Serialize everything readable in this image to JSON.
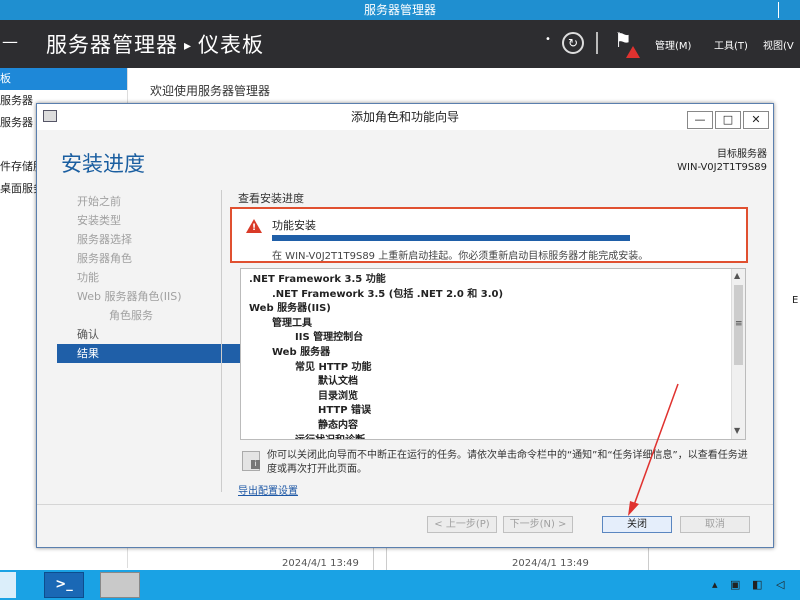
{
  "window_title": "服务器管理器",
  "header": {
    "crumb_app": "服务器管理器",
    "crumb_sep": "▸",
    "crumb_page": "仪表板",
    "menu_manage": "管理(M)",
    "menu_tools": "工具(T)",
    "menu_view": "视图(V"
  },
  "sidebar": {
    "items": [
      "板",
      "服务器",
      "服务器",
      "",
      "件存储服",
      "桌面服务"
    ]
  },
  "welcome": "欢迎使用服务器管理器",
  "right_edge": "E",
  "tiles": {
    "timestamp_1": "2024/4/1 13:49",
    "timestamp_2": "2024/4/1 13:49"
  },
  "wizard": {
    "title": "添加角色和功能向导",
    "btn_minimize": "—",
    "btn_maximize": "□",
    "btn_close": "✕",
    "heading": "安装进度",
    "dest_label": "目标服务器",
    "dest_server": "WIN-V0J2T1T9S89",
    "steps": [
      {
        "label": "开始之前",
        "state": "inactive"
      },
      {
        "label": "安装类型",
        "state": "inactive"
      },
      {
        "label": "服务器选择",
        "state": "inactive"
      },
      {
        "label": "服务器角色",
        "state": "inactive"
      },
      {
        "label": "功能",
        "state": "inactive"
      },
      {
        "label": "Web 服务器角色(IIS)",
        "state": "inactive"
      },
      {
        "label": "角色服务",
        "state": "inactive-sub"
      },
      {
        "label": "确认",
        "state": "done"
      },
      {
        "label": "结果",
        "state": "current"
      }
    ],
    "view_progress_label": "查看安装进度",
    "feature_install": {
      "title": "功能安装",
      "progress": 1.0,
      "message": "在 WIN-V0J2T1T9S89 上重新启动挂起。你必须重新启动目标服务器才能完成安装。"
    },
    "installed_items": [
      {
        "text": ".NET Framework 3.5 功能",
        "indent": 0
      },
      {
        "text": ".NET Framework 3.5 (包括 .NET 2.0 和 3.0)",
        "indent": 1
      },
      {
        "text": "Web 服务器(IIS)",
        "indent": 0
      },
      {
        "text": "管理工具",
        "indent": 1
      },
      {
        "text": "IIS 管理控制台",
        "indent": 2
      },
      {
        "text": "Web 服务器",
        "indent": 1
      },
      {
        "text": "常见 HTTP 功能",
        "indent": 2
      },
      {
        "text": "默认文档",
        "indent": 3
      },
      {
        "text": "目录浏览",
        "indent": 3
      },
      {
        "text": "HTTP 错误",
        "indent": 3
      },
      {
        "text": "静态内容",
        "indent": 3
      },
      {
        "text": "运行状况和诊断",
        "indent": 2
      }
    ],
    "info_text": "你可以关闭此向导而不中断正在运行的任务。请依次单击命令栏中的“通知”和“任务详细信息”，以查看任务进度或再次打开此页面。",
    "export_link": "导出配置设置",
    "btn_prev": "< 上一步(P)",
    "btn_next": "下一步(N) >",
    "btn_close_label": "关闭",
    "btn_cancel": "取消"
  },
  "annotation_color": "#e0322f"
}
